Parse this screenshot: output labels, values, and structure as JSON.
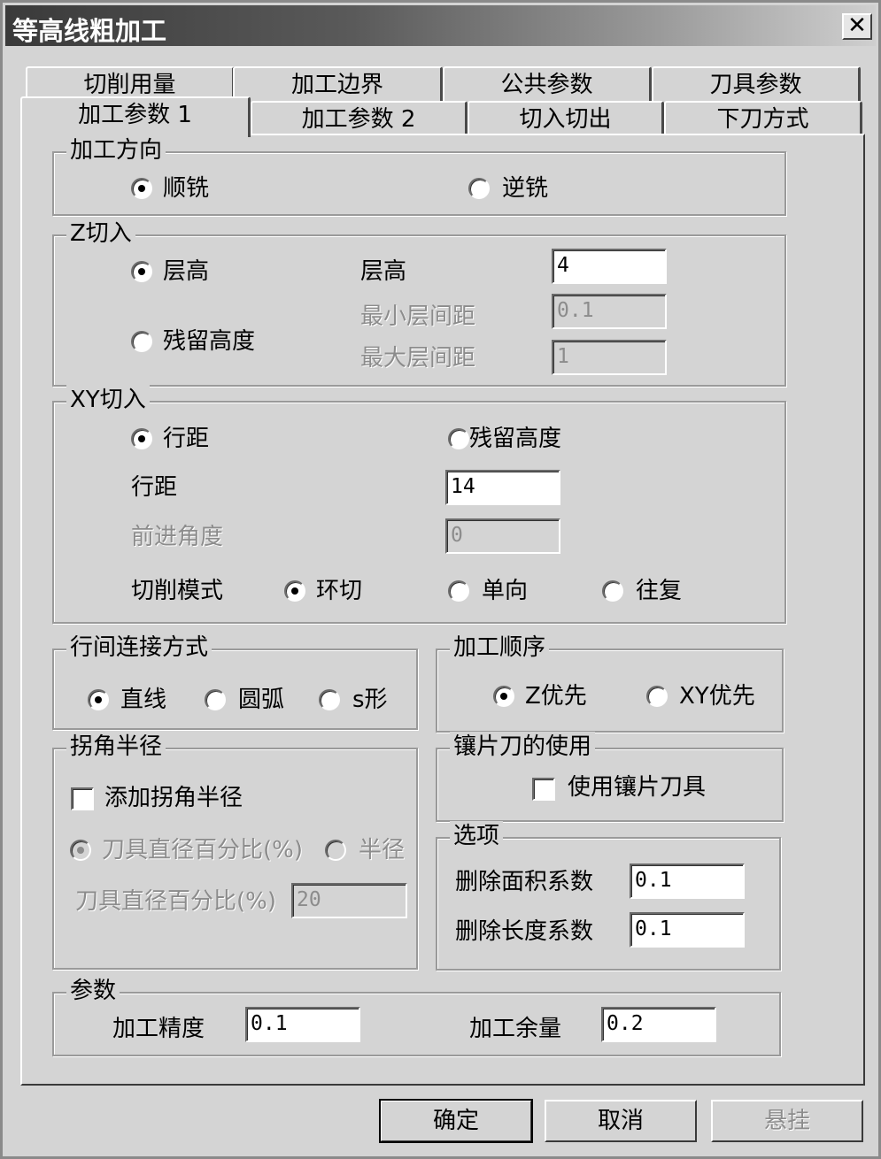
{
  "window": {
    "title": "等高线粗加工",
    "close_label": "✕"
  },
  "tabs": {
    "row_back": [
      "切削用量",
      "加工边界",
      "公共参数",
      "刀具参数"
    ],
    "row_front": [
      "加工参数 1",
      "加工参数 2",
      "切入切出",
      "下刀方式"
    ],
    "active": "加工参数 1"
  },
  "direction": {
    "legend": "加工方向",
    "options": [
      "顺铣",
      "逆铣"
    ],
    "selected": "顺铣"
  },
  "z_cut": {
    "legend": "Z切入",
    "options": [
      "层高",
      "残留高度"
    ],
    "selected": "层高",
    "layer_label": "层高",
    "layer_value": "4",
    "min_label": "最小层间距",
    "min_value": "0.1",
    "max_label": "最大层间距",
    "max_value": "1"
  },
  "xy_cut": {
    "legend": "XY切入",
    "options": [
      "行距",
      "残留高度"
    ],
    "selected": "行距",
    "spacing_label": "行距",
    "spacing_value": "14",
    "angle_label": "前进角度",
    "angle_value": "0",
    "mode_label": "切削模式",
    "modes": [
      "环切",
      "单向",
      "往复"
    ],
    "mode_selected": "环切"
  },
  "link": {
    "legend": "行间连接方式",
    "options": [
      "直线",
      "圆弧",
      "s形"
    ],
    "selected": "直线"
  },
  "order": {
    "legend": "加工顺序",
    "options": [
      "Z优先",
      "XY优先"
    ],
    "selected": "Z优先"
  },
  "corner": {
    "legend": "拐角半径",
    "checkbox_label": "添加拐角半径",
    "checked": false,
    "options": [
      "刀具直径百分比(%)",
      "半径"
    ],
    "selected": "刀具直径百分比(%)",
    "percent_label": "刀具直径百分比(%)",
    "percent_value": "20"
  },
  "insert_tool": {
    "legend": "镶片刀的使用",
    "checkbox_label": "使用镶片刀具",
    "checked": false
  },
  "options_group": {
    "legend": "选项",
    "area_label": "删除面积系数",
    "area_value": "0.1",
    "length_label": "删除长度系数",
    "length_value": "0.1"
  },
  "params": {
    "legend": "参数",
    "precision_label": "加工精度",
    "precision_value": "0.1",
    "allowance_label": "加工余量",
    "allowance_value": "0.2"
  },
  "buttons": {
    "ok": "确定",
    "cancel": "取消",
    "hang": "悬挂"
  }
}
